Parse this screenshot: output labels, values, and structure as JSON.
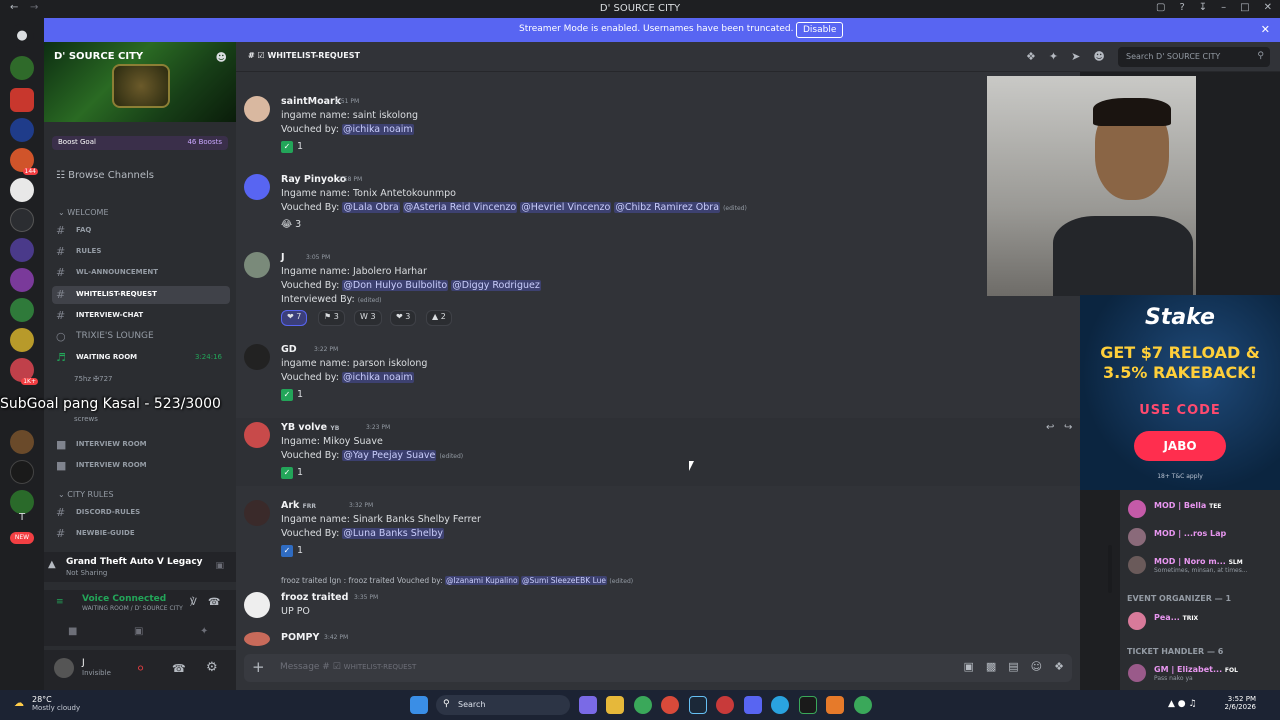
{
  "window": {
    "title": "D' SOURCE CITY"
  },
  "banner": {
    "text": "Streamer Mode is enabled. Usernames have been truncated.",
    "disable": "Disable"
  },
  "server": {
    "name": "D' SOURCE CITY",
    "boost_goal": "Boost Goal",
    "boosts": "46 Boosts",
    "browse": "Browse Channels"
  },
  "categories": {
    "welcome": "WELCOME",
    "city_rules": "CITY RULES"
  },
  "channels": [
    {
      "name": "FAQ"
    },
    {
      "name": "RULES"
    },
    {
      "name": "WL-ANNOUNCEMENT"
    },
    {
      "name": "WHITELIST-REQUEST"
    },
    {
      "name": "INTERVIEW-CHAT"
    },
    {
      "name": "TRIXIE'S LOUNGE"
    },
    {
      "name": "WAITING ROOM",
      "time": "3:24:16"
    },
    {
      "name": "INTERVIEW ROOM"
    },
    {
      "name": "INTERVIEW ROOM"
    },
    {
      "name": "DISCORD-RULES"
    },
    {
      "name": "NEWBIE-GUIDE"
    }
  ],
  "voice_users": [
    {
      "name": "75hz",
      "tag": "727"
    },
    {
      "name": "screws"
    }
  ],
  "overlay": {
    "subgoal": "SubGoal pang Kasal - 523/3000"
  },
  "activity": {
    "game": "Grand Theft Auto V Legacy",
    "status": "Not Sharing"
  },
  "voice": {
    "status": "Voice Connected",
    "channel": "WAITING ROOM / D' SOURCE CITY"
  },
  "user": {
    "name": "J",
    "status": "Invisible"
  },
  "chat": {
    "channel": "WHITELIST-REQUEST",
    "search_placeholder": "Search D' SOURCE CITY",
    "composer_placeholder": "Message #",
    "composer_channel": "WHITELIST-REQUEST"
  },
  "messages": [
    {
      "author": "saintMoark",
      "time": "2:51 PM",
      "lines": [
        "ingame name: saint iskolong"
      ],
      "vouched_label": "Vouched by:",
      "mentions": [
        "@ichika noaim"
      ],
      "react": "1"
    },
    {
      "author": "Ray Pinyoko",
      "time": "2:58 PM",
      "lines": [
        "Ingame name: Tonix Antetokounmpo"
      ],
      "vouched_label": "Vouched By:",
      "mentions": [
        "@Lala Obra",
        "@Asteria Reid Vincenzo",
        "@Hevriel Vincenzo",
        "@Chibz Ramirez Obra"
      ],
      "edited": "(edited)",
      "react": "3"
    },
    {
      "author": "J",
      "time": "3:05 PM",
      "lines": [
        "Ingame name: Jabolero Harhar"
      ],
      "vouched_label": "Vouched By:",
      "mentions": [
        "@Don Hulyo Bulbolito",
        "@Diggy Rodriguez"
      ],
      "interviewed": "Interviewed By:",
      "edited": "(edited)",
      "reacts": [
        "7",
        "3",
        "3",
        "3",
        "2"
      ]
    },
    {
      "author": "GD",
      "time": "3:22 PM",
      "lines": [
        "ingame name: parson iskolong"
      ],
      "vouched_label": "Vouched by:",
      "mentions": [
        "@ichika noaim"
      ],
      "react": "1"
    },
    {
      "author": "YB volve",
      "tag": "YB",
      "time": "3:23 PM",
      "lines": [
        "Ingame:  Mikoy Suave"
      ],
      "vouched_label": "Vouched By:",
      "mentions": [
        "@Yay Peejay Suave"
      ],
      "edited": "(edited)",
      "react": "1"
    },
    {
      "author": "Ark",
      "tag": "FRR",
      "time": "3:32 PM",
      "lines": [
        "Ingame name: Sinark Banks Shelby Ferrer"
      ],
      "vouched_label": "Vouched By:",
      "mentions": [
        "@Luna Banks Shelby"
      ],
      "react": "1"
    },
    {
      "author": "frooz traited",
      "time": "3:35 PM",
      "reply": "frooz traited Ign : frooz traited Vouched by:",
      "reply_mentions": [
        "@Izanami Kupalino",
        "@Sumi SleezeEBK Lue"
      ],
      "reply_edited": "(edited)",
      "lines": [
        "UP PO"
      ]
    },
    {
      "author": "POMPY",
      "time": "3:42 PM"
    }
  ],
  "ad": {
    "brand": "Stake",
    "offer": "GET $7 RELOAD & 3.5% RAKEBACK!",
    "use_code": "USE CODE",
    "code": "JABO",
    "tc": "18+ T&C apply"
  },
  "members": {
    "mods": [
      {
        "name": "MOD | Bella",
        "tag": "TEE"
      },
      {
        "name": "MOD | ...ros Lap",
        "tag": ""
      },
      {
        "name": "MOD | Noro m...",
        "tag": "SLM",
        "status": "Sometimes, minsan, at times..."
      }
    ],
    "event_organizer": "EVENT ORGANIZER — 1",
    "eo_member": {
      "name": "Pea...",
      "tag": "TRIX"
    },
    "ticket_handler": "TICKET HANDLER — 6",
    "th_member": {
      "name": "GM | Elizabet...",
      "tag": "FOL",
      "status": "Pass nako ya"
    }
  },
  "taskbar": {
    "temp": "28°C",
    "weather": "Mostly cloudy",
    "search": "Search",
    "time": "3:52 PM",
    "date": "2/6/2026"
  },
  "badges": {
    "new": "NEW",
    "t": "T",
    "count1": "144",
    "count2": "1K+"
  },
  "icons": [
    "discord-icon",
    "hash-icon",
    "search-icon",
    "plus-icon",
    "gift-icon",
    "gif-icon",
    "sticker-icon",
    "emoji-icon",
    "apps-icon",
    "pin-icon",
    "members-icon",
    "threads-icon",
    "bell-icon",
    "mic-icon",
    "headphones-icon",
    "gear-icon"
  ]
}
